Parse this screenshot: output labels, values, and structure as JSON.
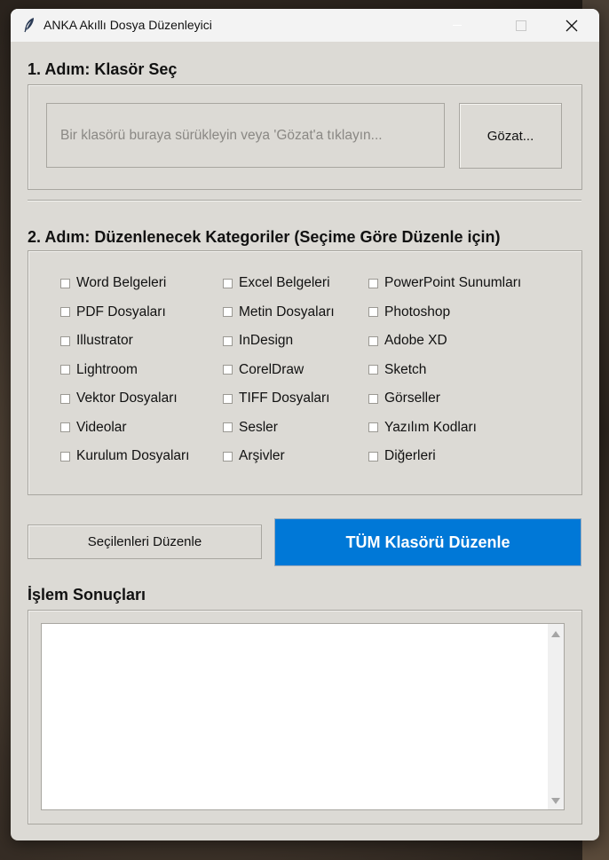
{
  "window": {
    "title": "ANKA Akıllı Dosya Düzenleyici"
  },
  "step1": {
    "heading": "1. Adım: Klasör Seç",
    "drop_placeholder": "Bir klasörü buraya sürükleyin veya 'Gözat'a tıklayın...",
    "browse_label": "Gözat..."
  },
  "step2": {
    "heading": "2. Adım: Düzenlenecek Kategoriler (Seçime Göre Düzenle için)",
    "categories": [
      [
        "Word Belgeleri",
        "Excel Belgeleri",
        "PowerPoint Sunumları"
      ],
      [
        "PDF Dosyaları",
        "Metin Dosyaları",
        "Photoshop"
      ],
      [
        "Illustrator",
        "InDesign",
        "Adobe XD"
      ],
      [
        "Lightroom",
        "CorelDraw",
        "Sketch"
      ],
      [
        "Vektor Dosyaları",
        "TIFF Dosyaları",
        "Görseller"
      ],
      [
        "Videolar",
        "Sesler",
        "Yazılım Kodları"
      ],
      [
        "Kurulum Dosyaları",
        "Arşivler",
        "Diğerleri"
      ]
    ]
  },
  "actions": {
    "organize_selected_label": "Seçilenleri Düzenle",
    "organize_all_label": "TÜM Klasörü Düzenle"
  },
  "results": {
    "heading": "İşlem Sonuçları",
    "text": ""
  },
  "colors": {
    "accent": "#0078d7",
    "window_bg": "#dcdad5"
  }
}
